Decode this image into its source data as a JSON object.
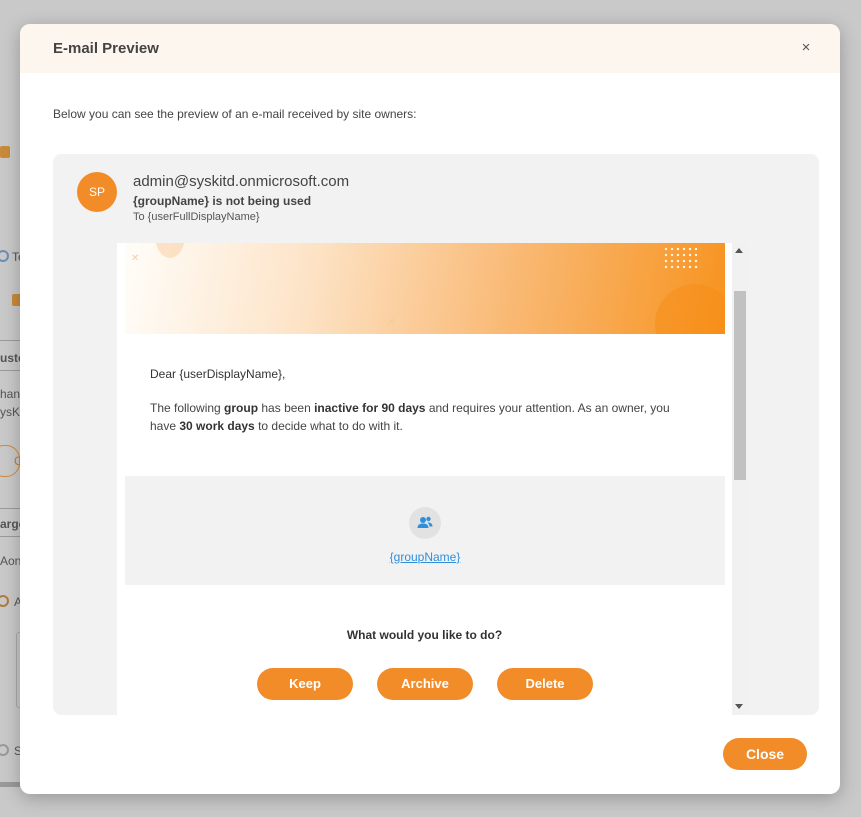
{
  "background_fragments": [
    "Te",
    "uste",
    "han",
    "ysKi",
    "C",
    "arge",
    "Aoni",
    "A",
    "S"
  ],
  "modal": {
    "title": "E-mail Preview",
    "close_icon": "×",
    "intro": "Below you can see the preview of an e-mail received by site owners:"
  },
  "email": {
    "avatar_initials": "SP",
    "sender": "admin@syskitd.onmicrosoft.com",
    "subject": "{groupName} is not being used",
    "recipient": "To {userFullDisplayName}",
    "greeting": "Dear {userDisplayName},",
    "body": {
      "p1": "The following ",
      "b1": "group",
      "p2": " has been ",
      "b2": "inactive for 90 days",
      "p3": " and requires your attention. As an owner, you have ",
      "b3": "30 work days",
      "p4": " to decide what to do with it."
    },
    "group_link": "{groupName}",
    "question": "What would you like to do?",
    "actions": {
      "keep": "Keep",
      "archive": "Archive",
      "delete": "Delete"
    }
  },
  "footer": {
    "close_label": "Close"
  },
  "colors": {
    "accent": "#f28c28",
    "link": "#2f8fdc",
    "header_bg": "#fdf6ef"
  }
}
